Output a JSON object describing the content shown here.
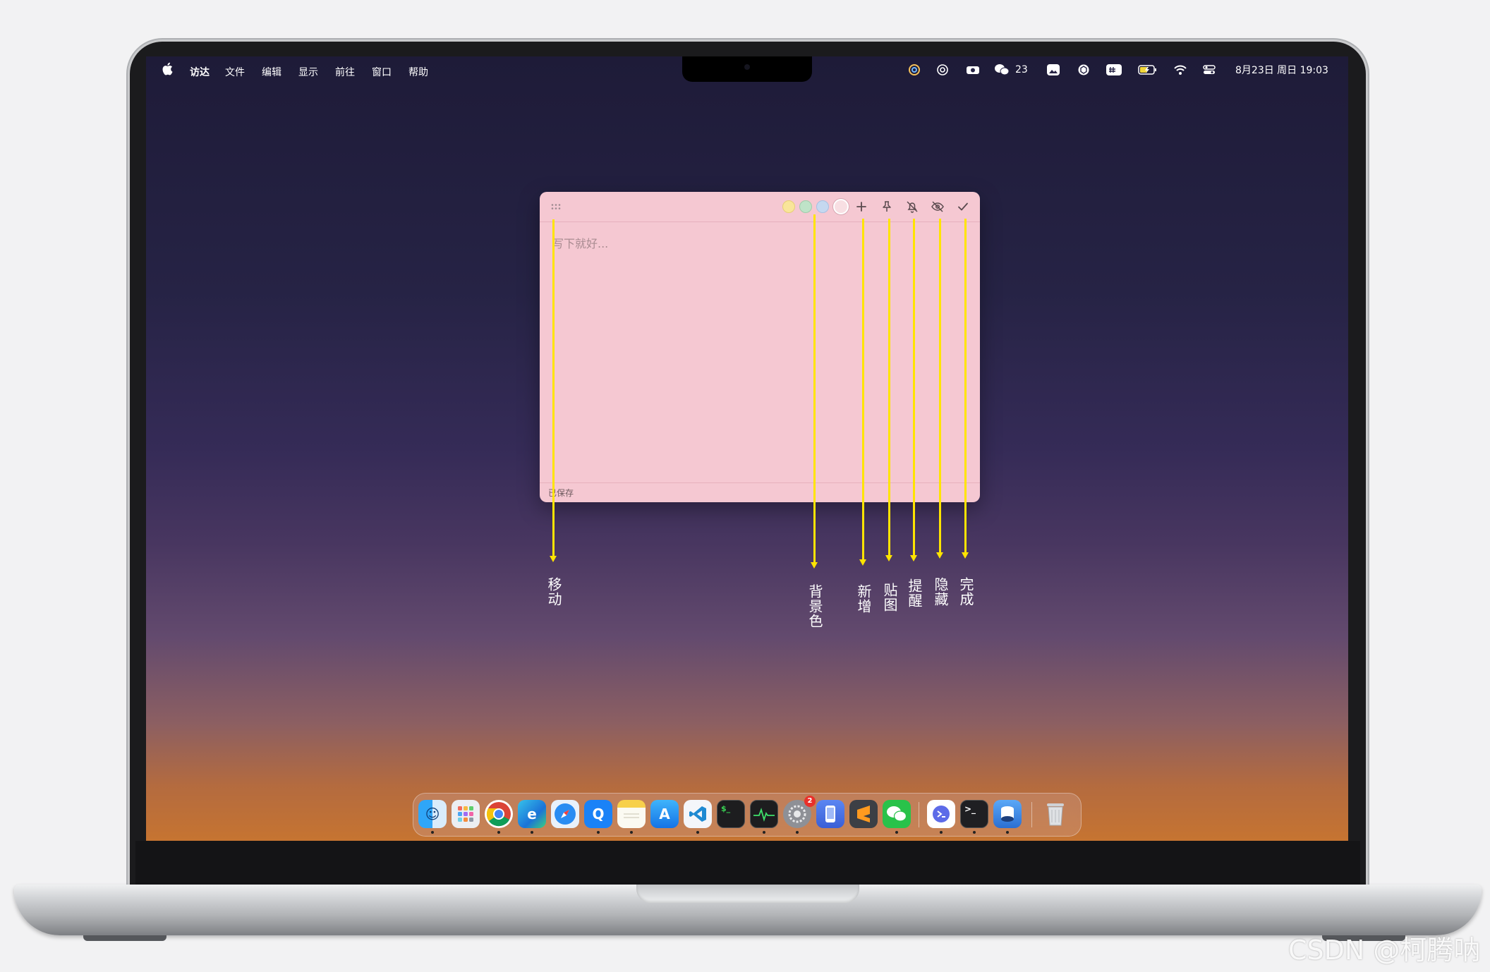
{
  "menubar": {
    "app_menu": "访达",
    "items": [
      "文件",
      "编辑",
      "显示",
      "前往",
      "窗口",
      "帮助"
    ],
    "wechat_count": "23",
    "clock": "8月23日 周日 19:03"
  },
  "note": {
    "placeholder": "写下就好...",
    "status": "已保存",
    "swatches": [
      "#f9e59a",
      "#bfe3c8",
      "#c5d8f0",
      "#f8dfe3"
    ],
    "background_color": "#f5c8d2"
  },
  "callouts": {
    "move": "移动",
    "background": "背景色",
    "add": "新增",
    "pin": "贴图",
    "remind": "提醒",
    "hide": "隐藏",
    "done": "完成"
  },
  "dock": {
    "apps": [
      "finder-icon",
      "launchpad-icon",
      "chrome-icon",
      "edge-icon",
      "safari-icon",
      "qq-browser-icon",
      "notes-icon",
      "app-store-icon",
      "vscode-icon",
      "terminal-icon",
      "activity-monitor-icon",
      "system-settings-icon",
      "simulator-icon",
      "sublime-text-icon",
      "wechat-icon",
      "remote-desktop-icon",
      "console-icon",
      "app-icon",
      "trash-icon"
    ],
    "settings_badge": "2"
  },
  "watermark": "CSDN @柯腾呐"
}
